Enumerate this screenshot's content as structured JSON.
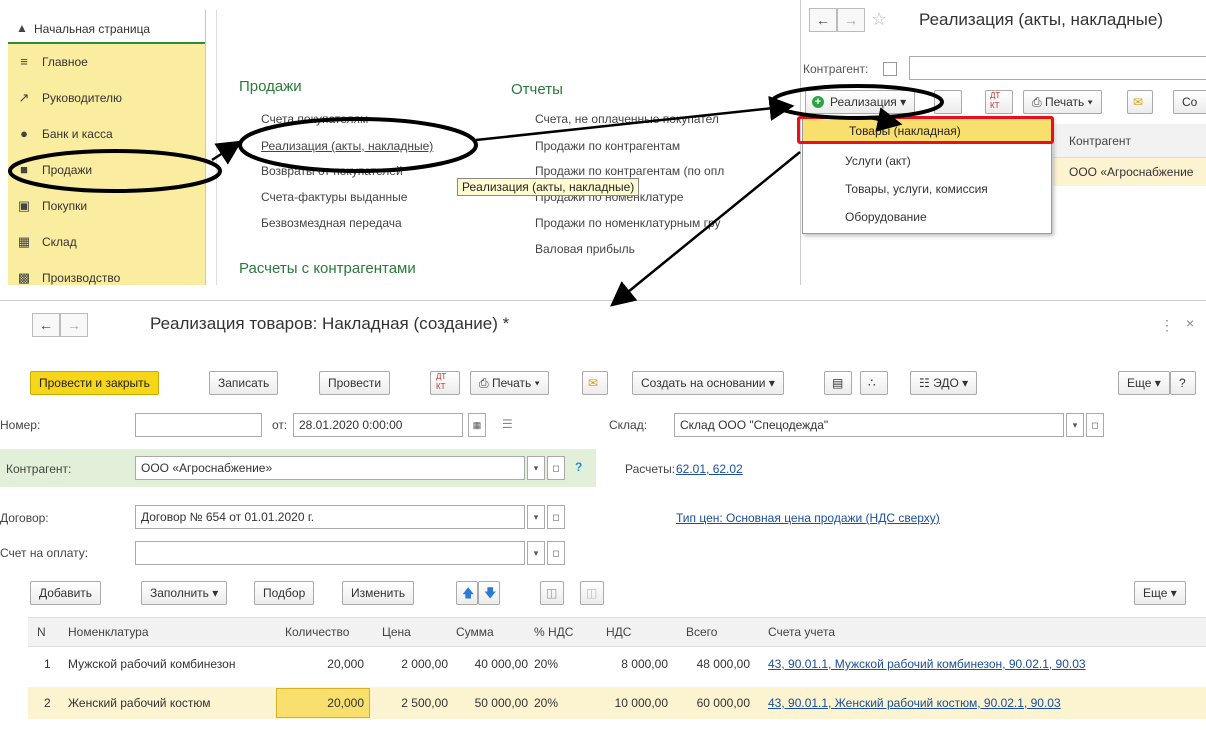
{
  "colors": {
    "sidebar_bg": "#faeda0",
    "accent_green": "#2b7a3a",
    "primary_button": "#f6d617",
    "highlight_row": "#fcf3d0",
    "selected_cell": "#f9df6e",
    "link": "#1a4fa0",
    "annotation_red": "#e8101a"
  },
  "sidebar": {
    "home": {
      "label": "Начальная страница",
      "icon": "home-icon"
    },
    "items": [
      {
        "label": "Главное",
        "icon": "menu-icon"
      },
      {
        "label": "Руководителю",
        "icon": "chart-trend-icon"
      },
      {
        "label": "Банк и касса",
        "icon": "ruble-coin-icon"
      },
      {
        "label": "Продажи",
        "icon": "shopping-bag-icon"
      },
      {
        "label": "Покупки",
        "icon": "cart-icon"
      },
      {
        "label": "Склад",
        "icon": "warehouse-icon"
      },
      {
        "label": "Производство",
        "icon": "factory-icon"
      }
    ]
  },
  "section": {
    "sales_title": "Продажи",
    "sales_links": [
      "Счета покупателям",
      "Реализация (акты, накладные)",
      "Возвраты от покупателей",
      "Счета-фактуры выданные",
      "Безвозмездная передача"
    ],
    "reports_title": "Отчеты",
    "reports_links": [
      "Счета, не оплаченные покупател",
      "Продажи по контрагентам",
      "Продажи по контрагентам (по опл",
      "Продажи по номенклатуре",
      "Продажи по номенклатурным гру",
      "Валовая прибыль"
    ],
    "settlements_title": "Расчеты с контрагентами",
    "tooltip": "Реализация (акты, накладные)"
  },
  "list_window": {
    "title": "Реализация (акты, накладные)",
    "filter_label": "Контрагент:",
    "create_button": "Реализация",
    "print_button": "Печать",
    "column_counterparty": "Контрагент",
    "row_counterparty": "ООО «Агроснабжение",
    "dropdown": [
      "Товары (накладная)",
      "Услуги (акт)",
      "Товары, услуги, комиссия",
      "Оборудование"
    ]
  },
  "document": {
    "title": "Реализация товаров: Накладная (создание) *",
    "toolbar": {
      "post_close": "Провести и закрыть",
      "save": "Записать",
      "post": "Провести",
      "print": "Печать",
      "create_based": "Создать на основании",
      "edo": "ЭДО",
      "more": "Еще",
      "help": "?"
    },
    "number_label": "Номер:",
    "number_value": "",
    "date_label": "от:",
    "date_value": "28.01.2020  0:00:00",
    "warehouse_label": "Склад:",
    "warehouse_value": "Склад ООО \"Спецодежда\"",
    "counterparty_label": "Контрагент:",
    "counterparty_value": "ООО «Агроснабжение»",
    "settlements_label": "Расчеты:",
    "settlements_value": "62.01, 62.02",
    "contract_label": "Договор:",
    "contract_value": "Договор № 654 от 01.01.2020 г.",
    "price_type": "Тип цен: Основная цена продажи (НДС сверху)",
    "invoice_label": "Счет на оплату:",
    "invoice_value": "",
    "table_toolbar": {
      "add": "Добавить",
      "fill": "Заполнить",
      "select": "Подбор",
      "change": "Изменить",
      "more": "Еще"
    },
    "columns": [
      "N",
      "Номенклатура",
      "Количество",
      "Цена",
      "Сумма",
      "% НДС",
      "НДС",
      "Всего",
      "Счета учета"
    ],
    "rows": [
      {
        "n": "1",
        "item": "Мужской рабочий комбинезон",
        "qty": "20,000",
        "price": "2 000,00",
        "sum": "40 000,00",
        "vat_rate": "20%",
        "vat": "8 000,00",
        "total": "48 000,00",
        "accounts": "43, 90.01.1, Мужской рабочий комбинезон, 90.02.1, 90.03"
      },
      {
        "n": "2",
        "item": "Женский рабочий костюм",
        "qty": "20,000",
        "price": "2 500,00",
        "sum": "50 000,00",
        "vat_rate": "20%",
        "vat": "10 000,00",
        "total": "60 000,00",
        "accounts": "43, 90.01.1, Женский рабочий костюм, 90.02.1, 90.03"
      }
    ]
  }
}
